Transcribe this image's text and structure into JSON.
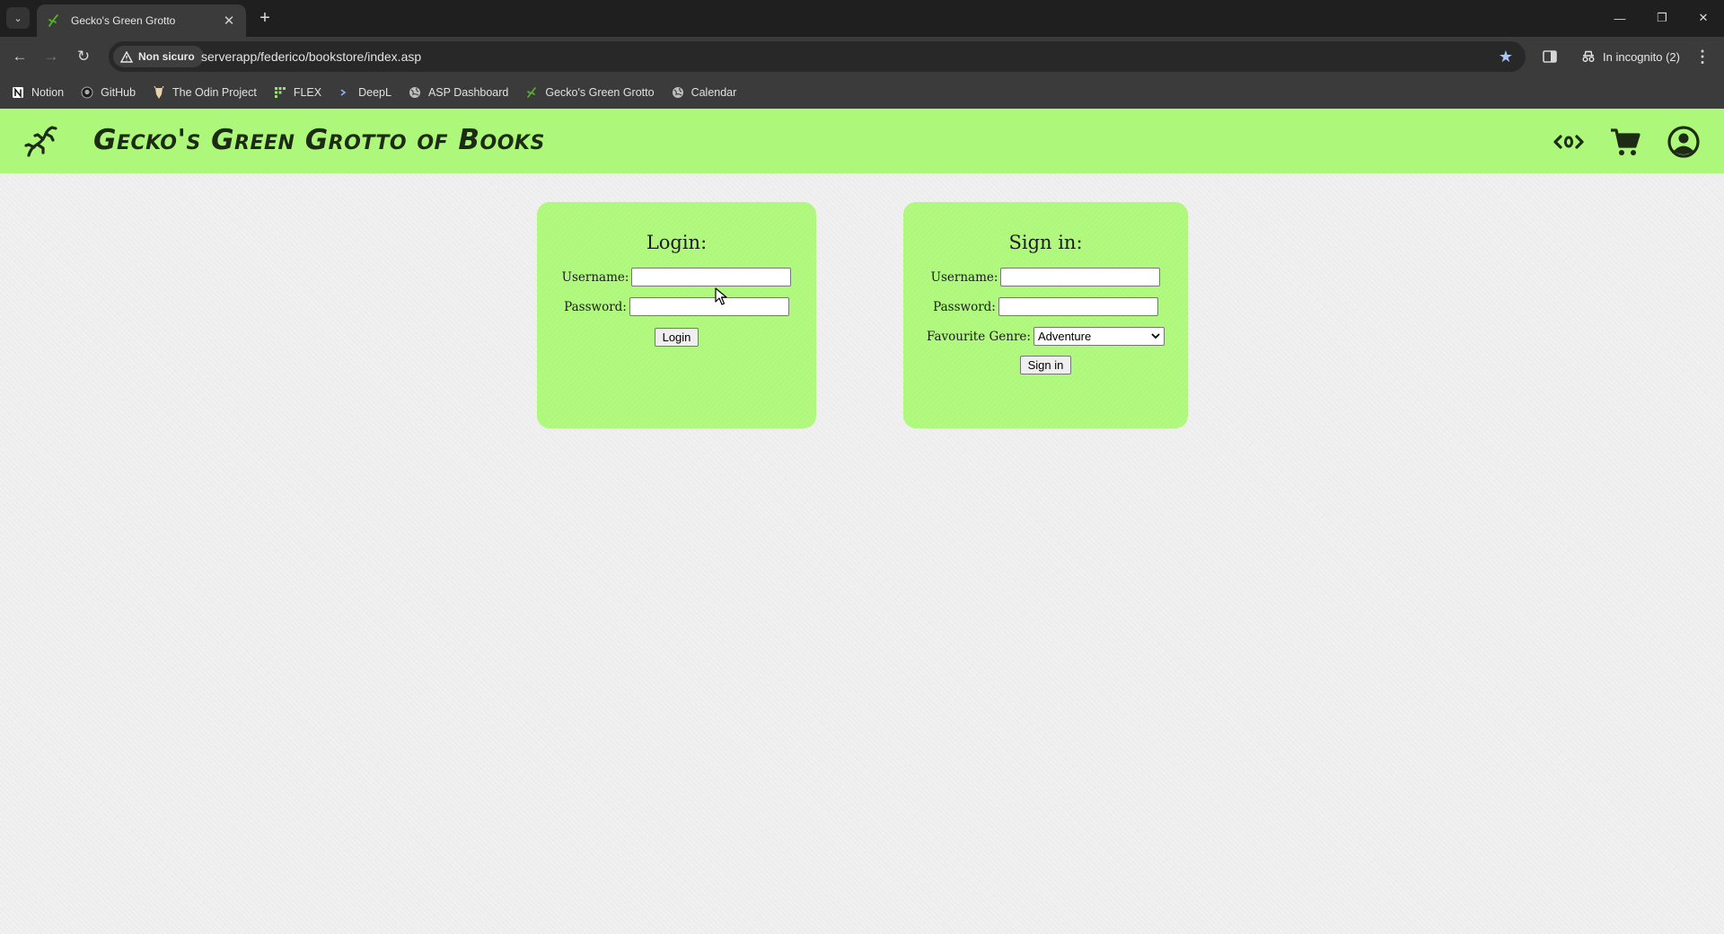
{
  "browser": {
    "tab_title": "Gecko's Green Grotto",
    "security_label": "Non sicuro",
    "url": "serverapp/federico/bookstore/index.asp",
    "incognito_label": "In incognito (2)",
    "bookmarks": [
      {
        "label": "Notion",
        "icon": "notion-icon"
      },
      {
        "label": "GitHub",
        "icon": "github-icon"
      },
      {
        "label": "The Odin Project",
        "icon": "odin-icon"
      },
      {
        "label": "FLEX",
        "icon": "flex-icon"
      },
      {
        "label": "DeepL",
        "icon": "deepl-icon"
      },
      {
        "label": "ASP Dashboard",
        "icon": "globe-icon"
      },
      {
        "label": "Gecko's Green Grotto",
        "icon": "gecko-icon"
      },
      {
        "label": "Calendar",
        "icon": "globe-icon"
      }
    ]
  },
  "site": {
    "title": "Gecko's Green Grotto of Books",
    "colors": {
      "header": "#adf87a",
      "title": "#1d2b14",
      "background": "#f1f1f1"
    }
  },
  "login": {
    "heading": "Login:",
    "username_label": "Username:",
    "password_label": "Password:",
    "username_value": "",
    "password_value": "",
    "button": "Login"
  },
  "signin": {
    "heading": "Sign in:",
    "username_label": "Username:",
    "password_label": "Password:",
    "genre_label": "Favourite Genre:",
    "genre_selected": "Adventure",
    "button": "Sign in"
  }
}
